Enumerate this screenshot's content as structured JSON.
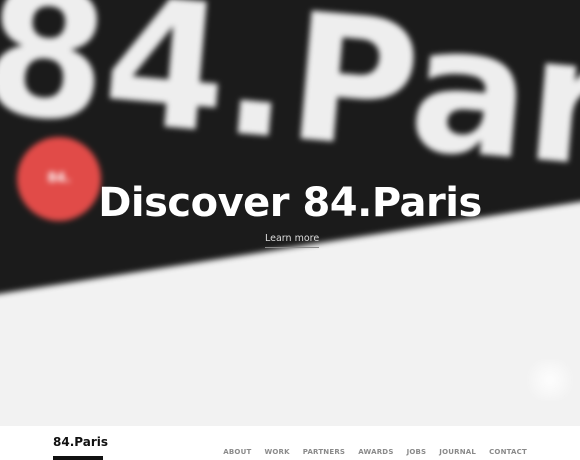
{
  "hero": {
    "background_word": "84.Par",
    "badge_text": "84.",
    "title": "Discover 84.Paris",
    "learn_more": "Learn more"
  },
  "nav": {
    "logo": "84.Paris",
    "items": [
      "ABOUT",
      "WORK",
      "PARTNERS",
      "AWARDS",
      "JOBS",
      "JOURNAL",
      "CONTACT"
    ]
  },
  "colors": {
    "accent_red": "#e14b48",
    "dark_band": "#1b1b1b",
    "nav_text": "#8a8a8a"
  }
}
